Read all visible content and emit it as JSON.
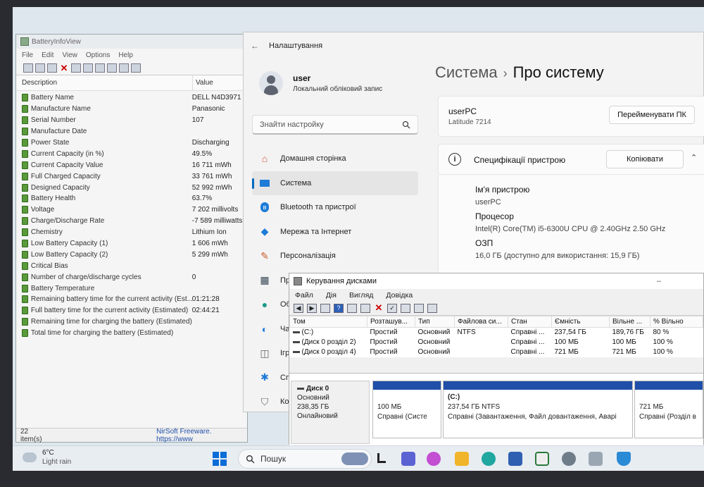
{
  "battery_view": {
    "title": "BatteryInfoView",
    "menu": [
      "File",
      "Edit",
      "View",
      "Options",
      "Help"
    ],
    "columns": {
      "description": "Description",
      "value": "Value"
    },
    "rows": [
      {
        "label": "Battery Name",
        "value": "DELL N4D3971"
      },
      {
        "label": "Manufacture Name",
        "value": "Panasonic"
      },
      {
        "label": "Serial Number",
        "value": "107"
      },
      {
        "label": "Manufacture Date",
        "value": ""
      },
      {
        "label": "Power State",
        "value": "Discharging"
      },
      {
        "label": "Current Capacity (in %)",
        "value": "49.5%"
      },
      {
        "label": "Current Capacity Value",
        "value": "16 711 mWh"
      },
      {
        "label": "Full Charged Capacity",
        "value": "33 761 mWh"
      },
      {
        "label": "Designed Capacity",
        "value": "52 992 mWh"
      },
      {
        "label": "Battery Health",
        "value": "63.7%"
      },
      {
        "label": "Voltage",
        "value": "7 202 millivolts"
      },
      {
        "label": "Charge/Discharge Rate",
        "value": "-7 589 milliwatts"
      },
      {
        "label": "Chemistry",
        "value": "Lithium Ion"
      },
      {
        "label": "Low Battery Capacity (1)",
        "value": "1 606 mWh"
      },
      {
        "label": "Low Battery Capacity (2)",
        "value": "5 299 mWh"
      },
      {
        "label": "Critical Bias",
        "value": ""
      },
      {
        "label": "Number of charge/discharge cycles",
        "value": "0"
      },
      {
        "label": "Battery Temperature",
        "value": ""
      },
      {
        "label": "Remaining battery time for the current activity (Est...",
        "value": "01:21:28"
      },
      {
        "label": "Full battery time for the current activity (Estimated)",
        "value": "02:44:21"
      },
      {
        "label": "Remaining time for charging the battery (Estimated)",
        "value": ""
      },
      {
        "label": "Total  time for charging the battery (Estimated)",
        "value": ""
      }
    ],
    "status_count": "22 item(s)",
    "status_nirsoft": "NirSoft Freeware. https://www"
  },
  "settings": {
    "title": "Налаштування",
    "user_name": "user",
    "user_type": "Локальний обліковий запис",
    "search_placeholder": "Знайти настройку",
    "nav": [
      {
        "label": "Домашня сторінка"
      },
      {
        "label": "Система"
      },
      {
        "label": "Bluetooth та пристрої"
      },
      {
        "label": "Мережа та Інтернет"
      },
      {
        "label": "Персоналізація"
      },
      {
        "label": "Пр"
      },
      {
        "label": "Об"
      },
      {
        "label": "Ча"
      },
      {
        "label": "Ігр"
      },
      {
        "label": "Сп"
      },
      {
        "label": "Ко"
      }
    ],
    "breadcrumb_parent": "Система",
    "breadcrumb_sep": "›",
    "breadcrumb_current": "Про систему",
    "pc_name": "userPC",
    "pc_model": "Latitude 7214",
    "rename_button": "Перейменувати ПК",
    "specs_title": "Специфікації пристрою",
    "copy_button": "Копіювати",
    "specs": [
      {
        "key": "Ім'я пристрою",
        "value": "userPC"
      },
      {
        "key": "Процесор",
        "value": "Intel(R) Core(TM) i5-6300U CPU @ 2.40GHz   2.50 GHz"
      },
      {
        "key": "ОЗП",
        "value": "16,0 ГБ (доступно для використання: 15,9 ГБ)"
      }
    ]
  },
  "disk_mgmt": {
    "title": "Керування дисками",
    "minimize": "–",
    "menu": [
      "Файл",
      "Дія",
      "Вигляд",
      "Довідка"
    ],
    "columns": [
      "Том",
      "Розташув...",
      "Тип",
      "Файлова си...",
      "Стан",
      "Ємність",
      "Вільне ...",
      "% Вільно"
    ],
    "volumes": [
      {
        "name": "(C:)",
        "layout": "Простий",
        "type": "Основний",
        "fs": "NTFS",
        "status": "Справні ...",
        "capacity": "237,54 ГБ",
        "free": "189,76 ГБ",
        "pct": "80 %"
      },
      {
        "name": "(Диск 0 розділ 2)",
        "layout": "Простий",
        "type": "Основний",
        "fs": "",
        "status": "Справні ...",
        "capacity": "100 МБ",
        "free": "100 МБ",
        "pct": "100 %"
      },
      {
        "name": "(Диск 0 розділ 4)",
        "layout": "Простий",
        "type": "Основний",
        "fs": "",
        "status": "Справні ...",
        "capacity": "721 МБ",
        "free": "721 МБ",
        "pct": "100 %"
      }
    ],
    "disk": {
      "name": "Диск 0",
      "type": "Основний",
      "size": "238,35 ГБ",
      "state": "Онлайновий"
    },
    "partitions": [
      {
        "title": "",
        "line1": "100 МБ",
        "line2": "Справні (Систе"
      },
      {
        "title": "(C:)",
        "line1": "237,54 ГБ NTFS",
        "line2": "Справні (Завантаження, Файл довантаження, Аварі"
      },
      {
        "title": "",
        "line1": "721 МБ",
        "line2": "Справні (Розділ в"
      }
    ]
  },
  "taskbar": {
    "temp": "6°C",
    "weather": "Light rain",
    "search": "Пошук"
  },
  "colors": {
    "accent": "#0067c0",
    "disk_bar": "#1f4fa8",
    "battery_icon": "#5a9a3a"
  }
}
